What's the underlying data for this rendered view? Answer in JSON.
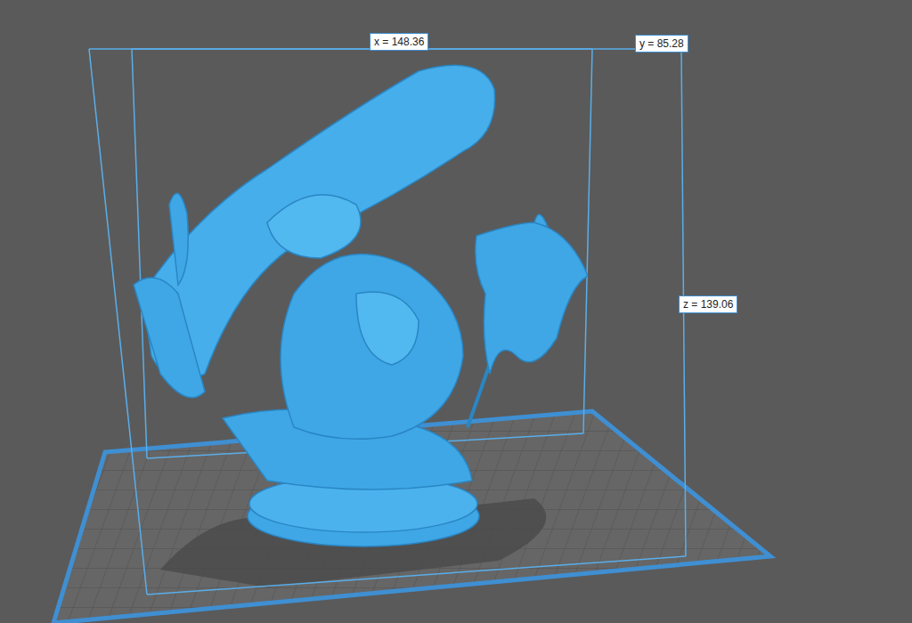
{
  "dimensions": [
    "x = 148.36",
    "y = 85.28",
    "z = 139.06"
  ]
}
